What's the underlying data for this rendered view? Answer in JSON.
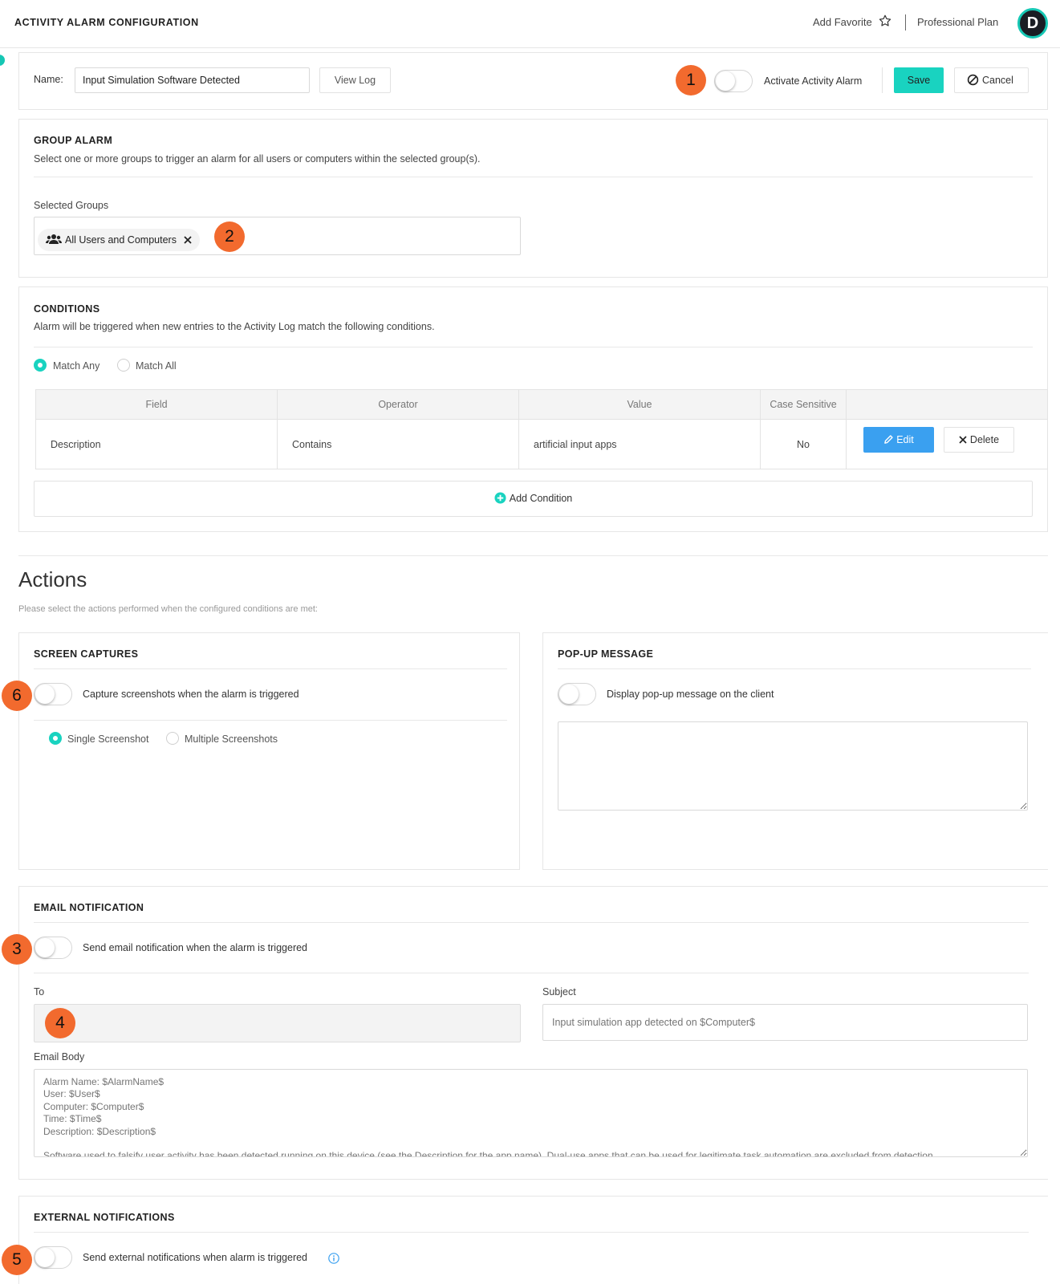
{
  "header": {
    "title": "ACTIVITY ALARM CONFIGURATION",
    "add_favorite": "Add Favorite",
    "plan": "Professional Plan",
    "avatar_initial": "D"
  },
  "toolbar": {
    "name_label": "Name:",
    "name_value": "Input Simulation Software Detected",
    "view_log": "View Log",
    "activate_label": "Activate Activity Alarm",
    "save": "Save",
    "cancel": "Cancel"
  },
  "group_alarm": {
    "title": "GROUP ALARM",
    "description": "Select one or more groups to trigger an alarm for all users or computers within the selected group(s).",
    "selected_label": "Selected Groups",
    "chip": "All Users and Computers"
  },
  "conditions": {
    "title": "CONDITIONS",
    "description": "Alarm will be triggered when new entries to the Activity Log match the following conditions.",
    "match_any": "Match Any",
    "match_all": "Match All",
    "columns": [
      "Field",
      "Operator",
      "Value",
      "Case Sensitive",
      ""
    ],
    "rows": [
      {
        "field": "Description",
        "operator": "Contains",
        "value": "artificial input apps",
        "case_sensitive": "No"
      }
    ],
    "edit": "Edit",
    "delete": "Delete",
    "add_condition": "Add Condition"
  },
  "actions": {
    "title": "Actions",
    "description": "Please select the actions performed when the configured conditions are met:"
  },
  "screen_captures": {
    "title": "SCREEN CAPTURES",
    "toggle_label": "Capture screenshots when the alarm is triggered",
    "single": "Single Screenshot",
    "multiple": "Multiple Screenshots"
  },
  "popup": {
    "title": "POP-UP MESSAGE",
    "toggle_label": "Display pop-up message on the client"
  },
  "email": {
    "title": "EMAIL NOTIFICATION",
    "toggle_label": "Send email notification when the alarm is triggered",
    "to_label": "To",
    "subject_label": "Subject",
    "subject_placeholder": "Input simulation app detected on $Computer$",
    "body_label": "Email Body",
    "body_placeholder": "Alarm Name: $AlarmName$\nUser: $User$\nComputer: $Computer$\nTime: $Time$\nDescription: $Description$\n\nSoftware used to falsify user activity has been detected running on this device (see the Description for the app name). Dual-use apps that can be used for legitimate task automation are excluded from detection."
  },
  "external": {
    "title": "EXTERNAL NOTIFICATIONS",
    "toggle_label": "Send external notifications when alarm is triggered"
  },
  "callouts": [
    "1",
    "2",
    "3",
    "4",
    "5",
    "6"
  ],
  "colors": {
    "accent": "#19d3c0",
    "edit_button": "#3aa0f0",
    "callout": "#f26a2e"
  }
}
